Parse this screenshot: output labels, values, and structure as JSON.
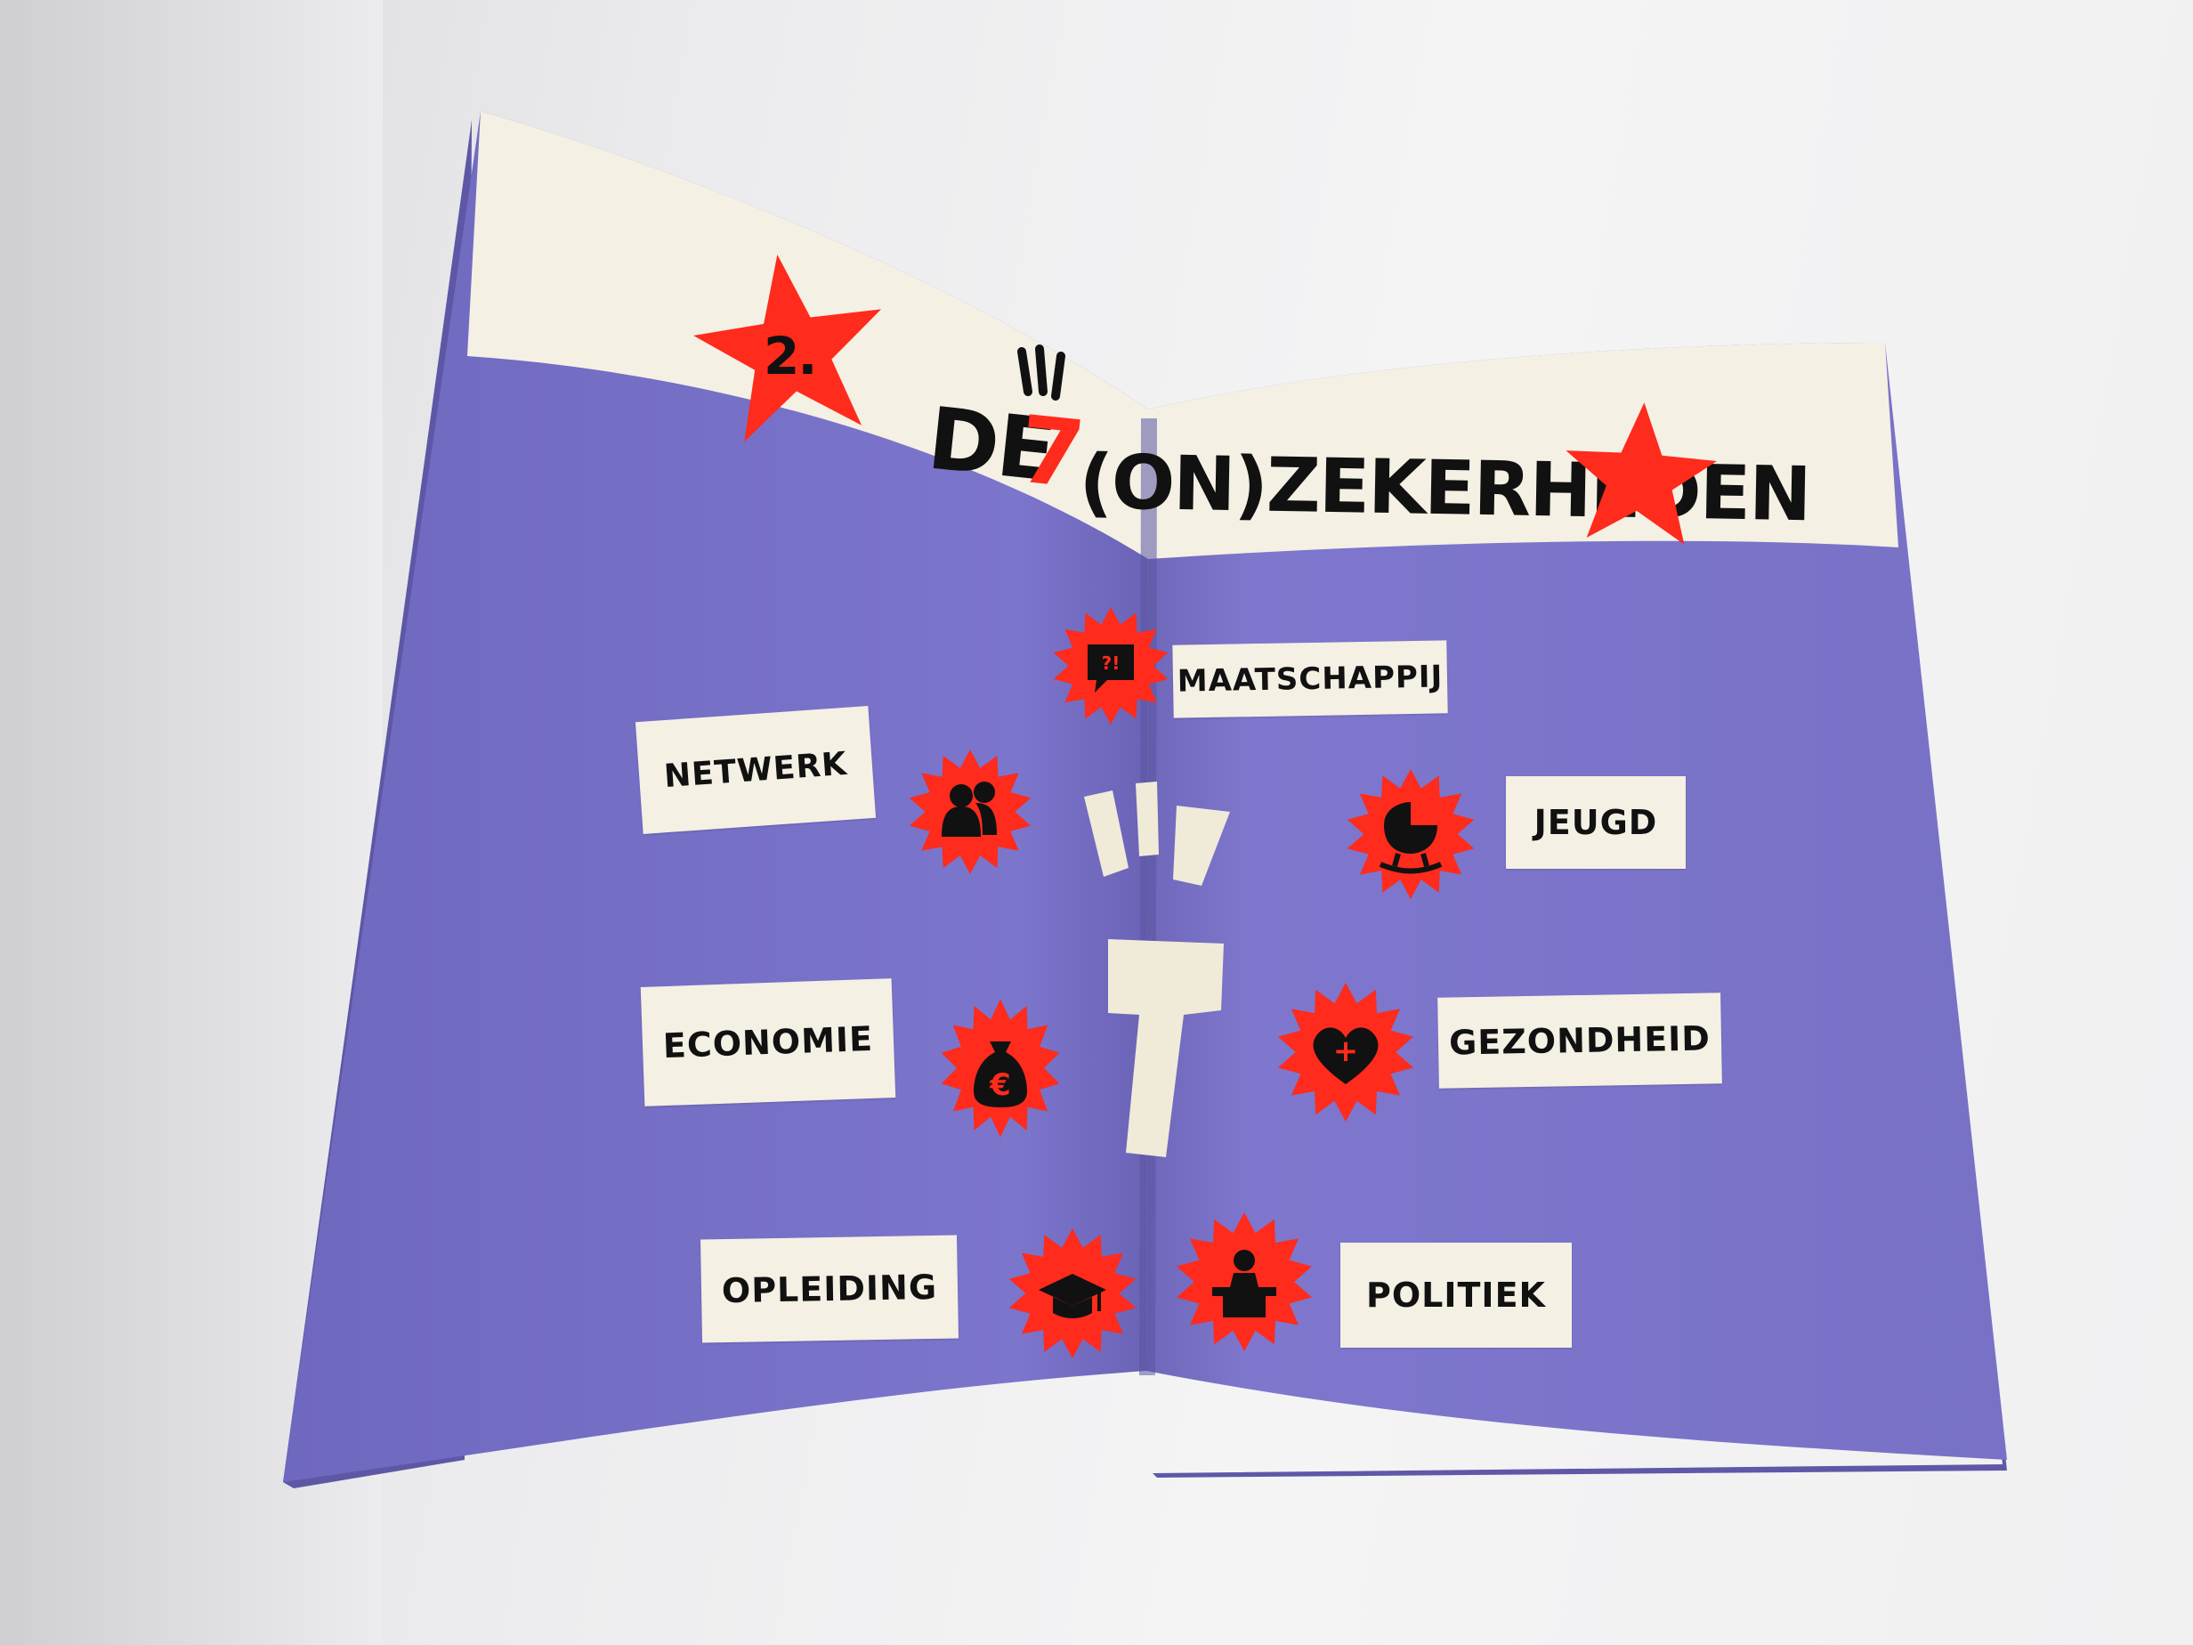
{
  "heading": {
    "number": "2.",
    "word_de": "DE",
    "numeral": "7",
    "word_rest": "(ON)ZEKERHEDEN"
  },
  "center_numeral": "7",
  "topics": {
    "maatschappij": "MAATSCHAPPIJ",
    "netwerk": "NETWERK",
    "jeugd": "JEUGD",
    "economie": "ECONOMIE",
    "gezondheid": "GEZONDHEID",
    "opleiding": "OPLEIDING",
    "politiek": "POLITIEK"
  },
  "icons": {
    "maatschappij": "speech-bubble-question-icon",
    "netwerk": "people-icon",
    "jeugd": "baby-carriage-icon",
    "economie": "money-bag-euro-icon",
    "gezondheid": "heart-plus-icon",
    "opleiding": "graduation-cap-icon",
    "politiek": "speaker-podium-icon"
  },
  "icon_glyphs": {
    "maatschappij": "?!",
    "economie": "€",
    "gezondheid": "+"
  },
  "colors": {
    "page_purple": "#7a73c6",
    "banner_cream": "#f4f0e4",
    "accent_red": "#ff2b1c",
    "ink": "#111111"
  }
}
